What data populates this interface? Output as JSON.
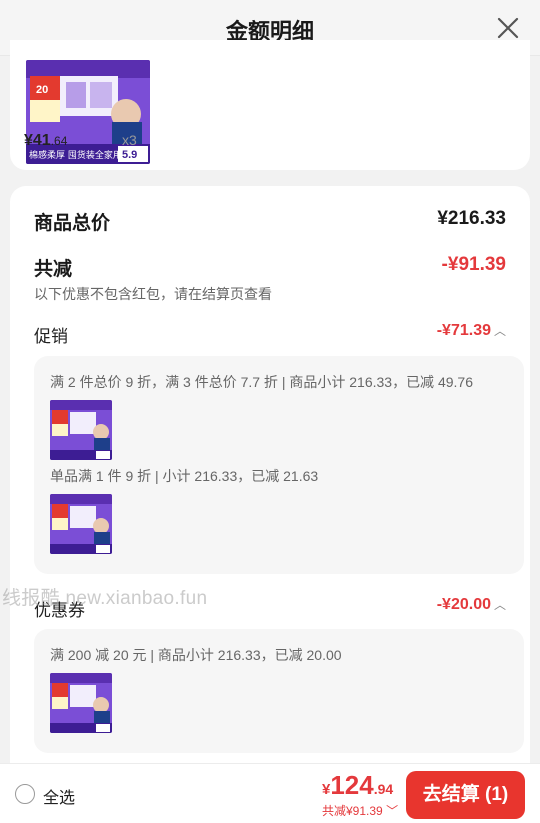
{
  "header": {
    "title": "金额明细"
  },
  "product": {
    "price_int": "¥41",
    "price_dec": ".64",
    "quantity": "x3",
    "image_texts": {
      "badge": "20",
      "slogan": "棉感柔厚 囤货装全家用",
      "price_tag": "5.9"
    }
  },
  "summary": {
    "total_label": "商品总价",
    "total_value": "¥216.33",
    "reduce_label": "共减",
    "reduce_value": "-¥91.39",
    "note": "以下优惠不包含红包，请在结算页查看"
  },
  "promotion": {
    "label": "促销",
    "value": "-¥71.39",
    "rule1": "满 2 件总价 9 折，满 3 件总价 7.7 折 | 商品小计 216.33，已减 49.76",
    "rule2": "单品满 1 件 9 折 | 小计 216.33，已减 21.63"
  },
  "coupon": {
    "label": "优惠券",
    "value": "-¥20.00",
    "rule1": "满 200 减 20 元 | 商品小计 216.33，已减 20.00"
  },
  "watermark": "线报酷 new.xianbao.fun",
  "footer": {
    "select_all": "全选",
    "price_currency": "¥",
    "price_int": "124",
    "price_dec": ".94",
    "saved": "共减¥91.39",
    "checkout": "去结算 (1)"
  },
  "colors": {
    "accent": "#e4393c",
    "button": "#e8352e",
    "product_purple": "#6a3cc0"
  }
}
